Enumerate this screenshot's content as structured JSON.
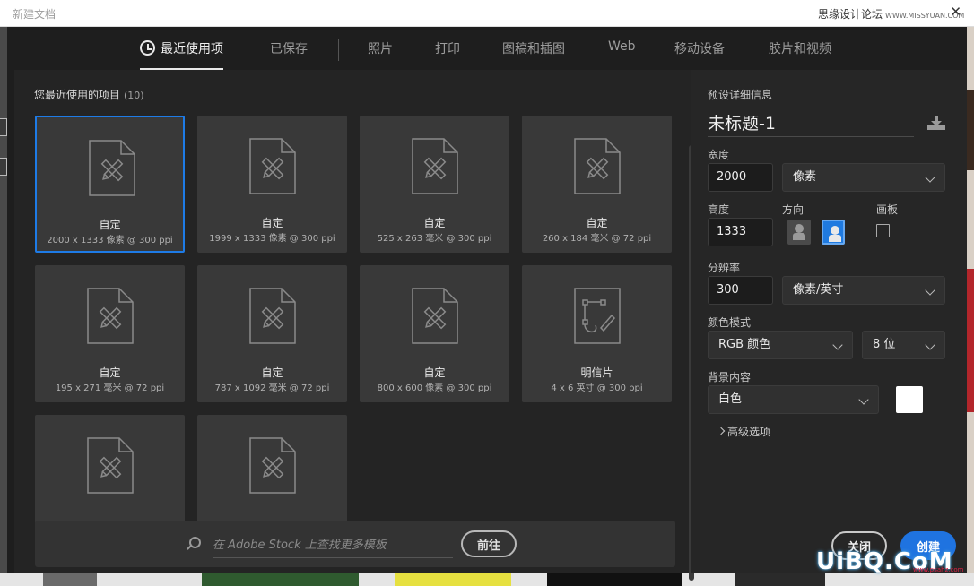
{
  "window": {
    "title": "新建文档",
    "site_name": "思缘设计论坛",
    "site_url": "WWW.MISSYUAN.COM",
    "close_glyph": "✕"
  },
  "tabs": [
    {
      "label": "最近使用项",
      "active": true
    },
    {
      "label": "已保存"
    },
    {
      "label": "照片"
    },
    {
      "label": "打印"
    },
    {
      "label": "图稿和插图"
    },
    {
      "label": "Web"
    },
    {
      "label": "移动设备"
    },
    {
      "label": "胶片和视频"
    }
  ],
  "recent": {
    "heading": "您最近使用的项目",
    "count": "(10)",
    "items": [
      {
        "name": "自定",
        "size": "2000 x 1333 像素 @ 300 ppi",
        "icon": "document-ruler-pencil-icon",
        "selected": true
      },
      {
        "name": "自定",
        "size": "1999 x 1333 像素 @ 300 ppi",
        "icon": "document-ruler-pencil-icon"
      },
      {
        "name": "自定",
        "size": "525 x 263 毫米 @ 300 ppi",
        "icon": "document-ruler-pencil-icon"
      },
      {
        "name": "自定",
        "size": "260 x 184 毫米 @ 72 ppi",
        "icon": "document-ruler-pencil-icon"
      },
      {
        "name": "自定",
        "size": "195 x 271 毫米 @ 72 ppi",
        "icon": "document-ruler-pencil-icon"
      },
      {
        "name": "自定",
        "size": "787 x 1092 毫米 @ 72 ppi",
        "icon": "document-ruler-pencil-icon"
      },
      {
        "name": "自定",
        "size": "800 x 600 像素 @ 300 ppi",
        "icon": "document-ruler-pencil-icon"
      },
      {
        "name": "明信片",
        "size": "4 x 6 英寸 @ 300 ppi",
        "icon": "document-pen-path-icon"
      },
      {
        "name": "",
        "size": "",
        "icon": "document-ruler-pencil-icon"
      },
      {
        "name": "",
        "size": "",
        "icon": "document-ruler-pencil-icon"
      }
    ]
  },
  "search": {
    "placeholder": "在 Adobe Stock 上查找更多模板",
    "go_label": "前往"
  },
  "preset": {
    "heading": "预设详细信息",
    "name": "未标题-1",
    "width_label": "宽度",
    "width_value": "2000",
    "width_unit": "像素",
    "height_label": "高度",
    "height_value": "1333",
    "orientation_label": "方向",
    "artboard_label": "画板",
    "resolution_label": "分辨率",
    "resolution_value": "300",
    "resolution_unit": "像素/英寸",
    "color_mode_label": "颜色模式",
    "color_mode": "RGB 颜色",
    "bit_depth": "8 位",
    "background_label": "背景内容",
    "background": "白色",
    "background_color": "#ffffff",
    "advanced_label": "高级选项"
  },
  "actions": {
    "close_label": "关闭",
    "create_label": "创建"
  },
  "watermark": {
    "text": "UiBQ.CoM",
    "sub": "www.psahz.com"
  },
  "colors": {
    "accent": "#1f73e0",
    "dialog_bg": "#1e1e1e",
    "tile_bg": "#393939"
  }
}
